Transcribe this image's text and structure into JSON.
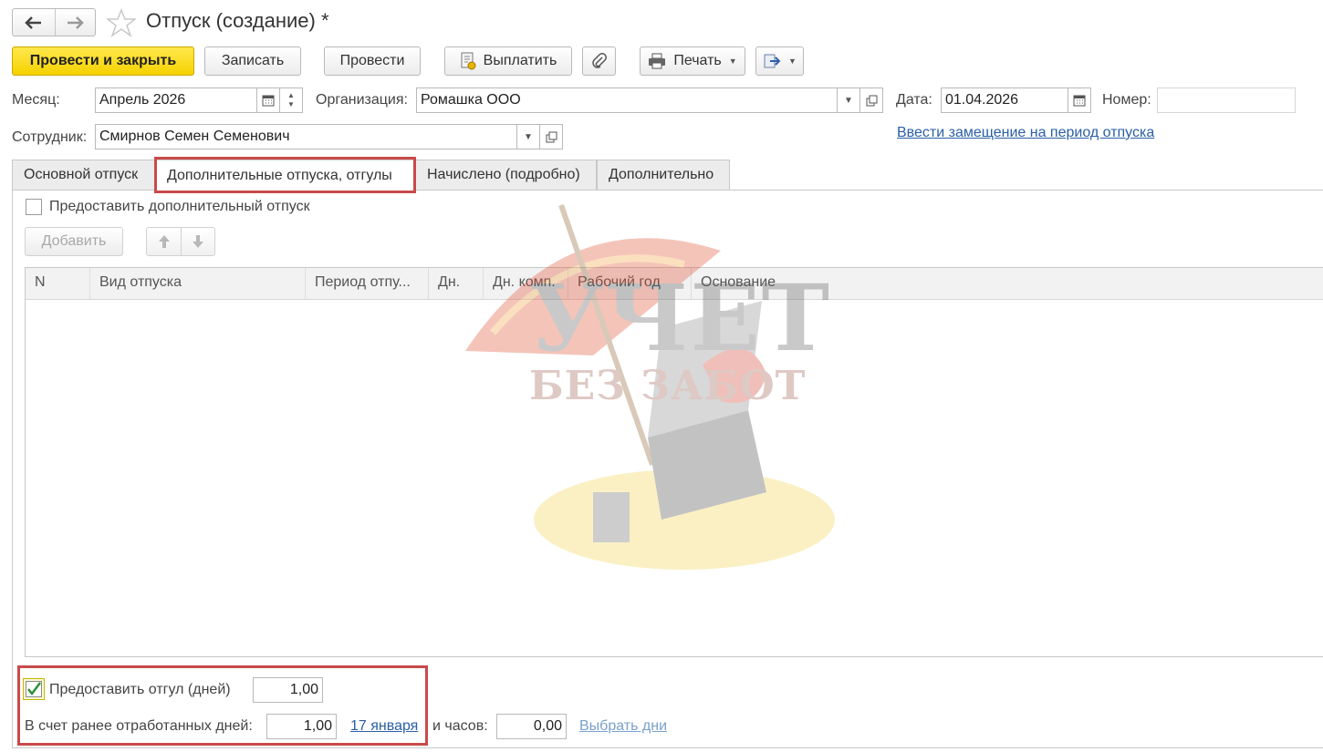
{
  "window": {
    "title": "Отпуск (создание) *"
  },
  "toolbar": {
    "post_close": "Провести и закрыть",
    "save": "Записать",
    "post": "Провести",
    "pay": "Выплатить",
    "print": "Печать"
  },
  "header": {
    "month_label": "Месяц:",
    "month_value": "Апрель 2026",
    "org_label": "Организация:",
    "org_value": "Ромашка ООО",
    "date_label": "Дата:",
    "date_value": "01.04.2026",
    "number_label": "Номер:",
    "number_value": "",
    "employee_label": "Сотрудник:",
    "employee_value": "Смирнов Семен Семенович",
    "substitution_link": "Ввести замещение на период отпуска"
  },
  "tabs": [
    {
      "label": "Основной отпуск"
    },
    {
      "label": "Дополнительные отпуска, отгулы"
    },
    {
      "label": "Начислено (подробно)"
    },
    {
      "label": "Дополнительно"
    }
  ],
  "additional": {
    "grant_checkbox_label": "Предоставить дополнительный отпуск",
    "grant_checked": false,
    "add_button": "Добавить",
    "columns": [
      "N",
      "Вид отпуска",
      "Период отпу...",
      "Дн.",
      "Дн. комп.",
      "Рабочий год",
      "Основание"
    ]
  },
  "watermark": {
    "line1": "УЧЕТ",
    "line2": "БЕЗ ЗАБОТ"
  },
  "dayoff": {
    "grant_label": "Предоставить отгул (дней)",
    "grant_checked": true,
    "grant_days": "1,00",
    "worked_label": "В счет ранее отработанных дней:",
    "worked_days": "1,00",
    "worked_date_link": "17 января",
    "hours_label": "и часов:",
    "hours_value": "0,00",
    "choose_days_link": "Выбрать дни"
  }
}
